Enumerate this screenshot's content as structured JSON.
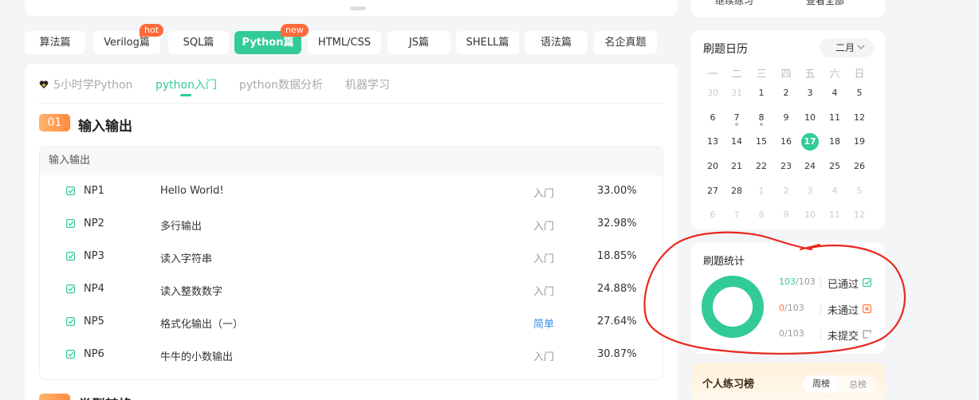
{
  "top_tabs": [
    {
      "label": "算法篇",
      "badge": ""
    },
    {
      "label": "Verilog篇",
      "badge": "hot"
    },
    {
      "label": "SQL篇",
      "badge": ""
    },
    {
      "label": "Python篇",
      "badge": "new"
    },
    {
      "label": "HTML/CSS",
      "badge": ""
    },
    {
      "label": "JS篇",
      "badge": ""
    },
    {
      "label": "SHELL篇",
      "badge": ""
    },
    {
      "label": "语法篇",
      "badge": ""
    },
    {
      "label": "名企真题",
      "badge": ""
    }
  ],
  "sub_tabs": [
    "5小时学Python",
    "python入门",
    "python数据分析",
    "机器学习"
  ],
  "section": {
    "number": "01",
    "title": "输入输出",
    "table_header": "输入输出"
  },
  "problems": [
    {
      "code": "NP1",
      "name": "Hello World!",
      "difficulty": "入门",
      "rate": "33.00%"
    },
    {
      "code": "NP2",
      "name": "多行输出",
      "difficulty": "入门",
      "rate": "32.98%"
    },
    {
      "code": "NP3",
      "name": "读入字符串",
      "difficulty": "入门",
      "rate": "18.85%"
    },
    {
      "code": "NP4",
      "name": "读入整数数字",
      "difficulty": "入门",
      "rate": "24.88%"
    },
    {
      "code": "NP5",
      "name": "格式化输出（一）",
      "difficulty": "简单",
      "rate": "27.64%"
    },
    {
      "code": "NP6",
      "name": "牛牛的小数输出",
      "difficulty": "入门",
      "rate": "30.87%"
    }
  ],
  "section2_title": "类型转换",
  "side_top": {
    "continue_label": "继续练习",
    "view_all_label": "查看全部"
  },
  "calendar": {
    "title": "刷题日历",
    "month": "二月",
    "weekdays": [
      "一",
      "二",
      "三",
      "四",
      "五",
      "六",
      "日"
    ],
    "days": [
      "30",
      "31",
      "1",
      "2",
      "3",
      "4",
      "5",
      "6",
      "7",
      "8",
      "9",
      "10",
      "11",
      "12",
      "13",
      "14",
      "15",
      "16",
      "17",
      "18",
      "19",
      "20",
      "21",
      "22",
      "23",
      "24",
      "25",
      "26",
      "27",
      "28",
      "1",
      "2",
      "3",
      "4",
      "5",
      "6",
      "7",
      "8",
      "9",
      "10",
      "11",
      "12"
    ],
    "today": "17"
  },
  "stats": {
    "title": "刷题统计",
    "passed": {
      "value": "103",
      "total": "/103",
      "label": "已通过"
    },
    "failed": {
      "value": "0",
      "total": "/103",
      "label": "未通过"
    },
    "unsubmitted": {
      "value": "0",
      "total": "/103",
      "label": "未提交"
    },
    "colors": {
      "passed": "#32ca99",
      "failed": "#ff7a3c"
    }
  },
  "ranking": {
    "title": "个人练习榜",
    "tabs": [
      "周榜",
      "总榜"
    ]
  }
}
